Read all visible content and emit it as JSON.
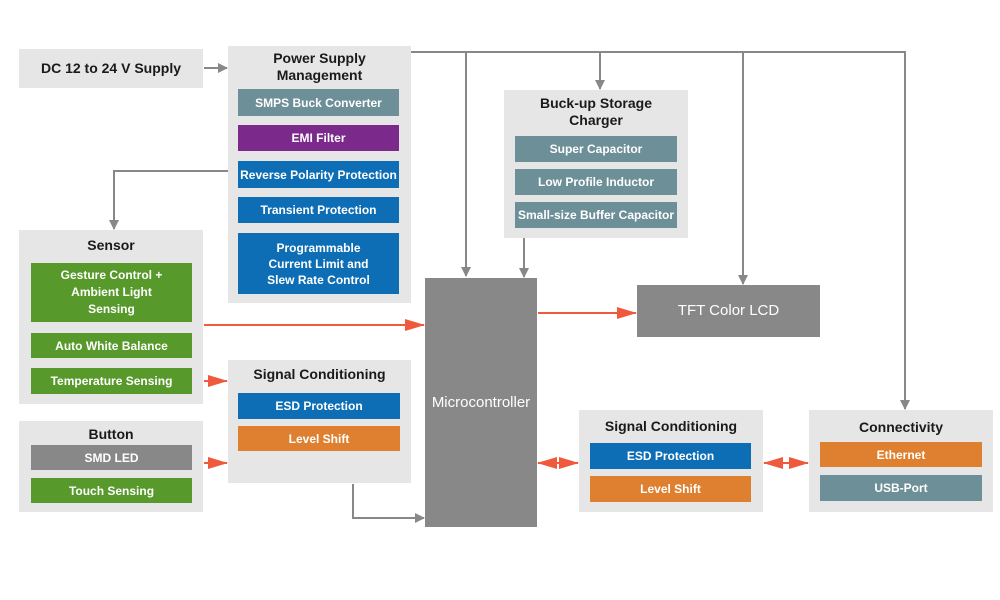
{
  "colors": {
    "connector": "#888888",
    "signal": "#f05a3c",
    "teal": "#6d8f98",
    "purple": "#7b2a8c",
    "blue": "#0e6eb5",
    "green": "#57992a",
    "orange": "#de8030",
    "gray": "#888888"
  },
  "supply": {
    "label": "DC 12 to 24 V Supply"
  },
  "power": {
    "title": "Power Supply Management",
    "items": [
      "SMPS Buck Converter",
      "EMI Filter",
      "Reverse Polarity Protection",
      "Transient Protection",
      "Programmable Current Limit and Slew Rate Control"
    ]
  },
  "buckup": {
    "title": "Buck-up Storage Charger",
    "items": [
      "Super Capacitor",
      "Low Profile Inductor",
      "Small-size Buffer Capacitor"
    ]
  },
  "sensor": {
    "title": "Sensor",
    "items": [
      "Gesture Control + Ambient Light Sensing",
      "Auto White Balance",
      "Temperature Sensing"
    ]
  },
  "button": {
    "title": "Button",
    "items": [
      "SMD LED",
      "Touch Sensing"
    ]
  },
  "signal1": {
    "title": "Signal Conditioning",
    "items": [
      "ESD Protection",
      "Level Shift"
    ]
  },
  "mcu": {
    "label": "Microcontroller"
  },
  "lcd": {
    "label": "TFT Color LCD"
  },
  "signal2": {
    "title": "Signal Conditioning",
    "items": [
      "ESD Protection",
      "Level Shift"
    ]
  },
  "connectivity": {
    "title": "Connectivity",
    "items": [
      "Ethernet",
      "USB-Port"
    ]
  }
}
